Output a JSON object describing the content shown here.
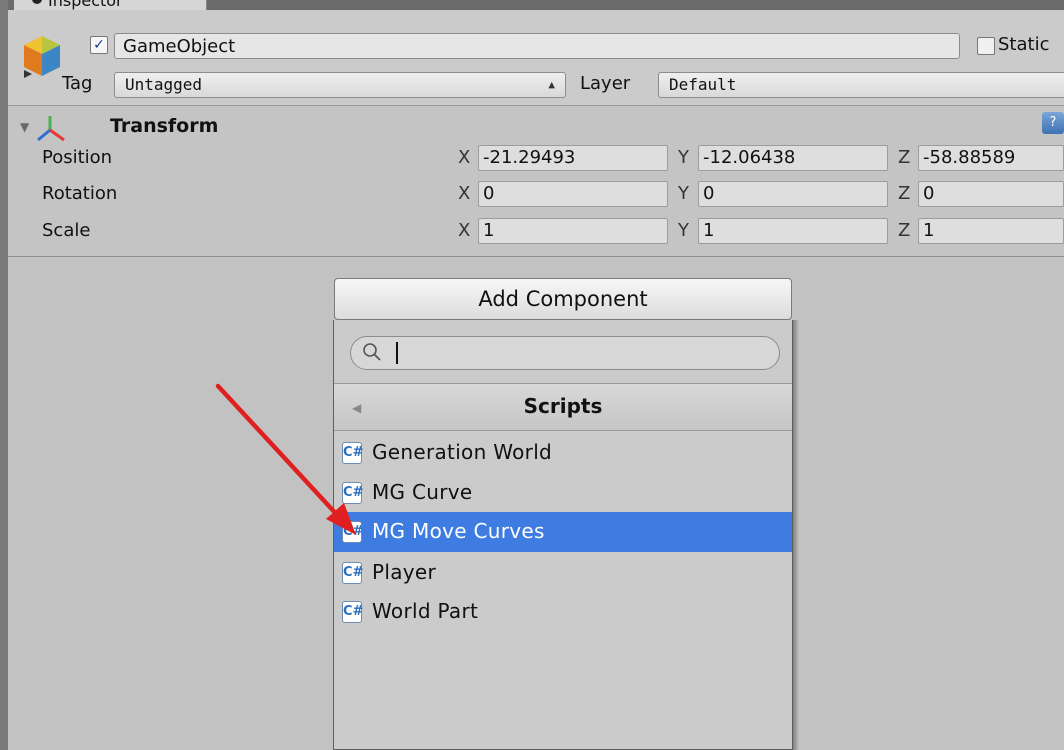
{
  "tab": {
    "title": "Inspector"
  },
  "header": {
    "name": "GameObject",
    "active_checked": true,
    "static_label": "Static",
    "tag_label": "Tag",
    "tag_value": "Untagged",
    "layer_label": "Layer",
    "layer_value": "Default"
  },
  "transform": {
    "title": "Transform",
    "rows": [
      {
        "label": "Position",
        "x": "-21.29493",
        "y": "-12.06438",
        "z": "-58.88589"
      },
      {
        "label": "Rotation",
        "x": "0",
        "y": "0",
        "z": "0"
      },
      {
        "label": "Scale",
        "x": "1",
        "y": "1",
        "z": "1"
      }
    ],
    "axis_labels": {
      "x": "X",
      "y": "Y",
      "z": "Z"
    }
  },
  "add_component": {
    "button_label": "Add Component",
    "search_value": "",
    "category": "Scripts",
    "items": [
      {
        "label": "Generation World",
        "selected": false
      },
      {
        "label": "MG Curve",
        "selected": false
      },
      {
        "label": "MG Move Curves",
        "selected": true
      },
      {
        "label": "Player",
        "selected": false
      },
      {
        "label": "World Part",
        "selected": false
      }
    ]
  },
  "colors": {
    "selection": "#3e7ce2",
    "annotation_arrow": "#e02020"
  },
  "icons": {
    "gameobject": "cube-icon",
    "transform": "transform-axes-icon",
    "help": "help-icon",
    "search": "search-icon",
    "script": "csharp-script-icon"
  }
}
